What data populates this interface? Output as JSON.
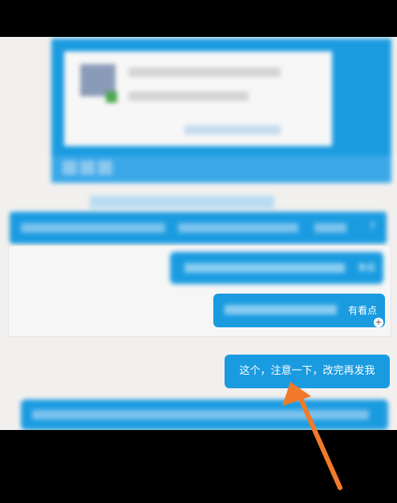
{
  "conversation": {
    "reply_message": "这个，注意一下，改完再发我",
    "partial_label": "有看点",
    "mini_label": "来自",
    "counter": "7"
  },
  "icons": {
    "add": "plus-icon",
    "annotation": "orange-arrow"
  },
  "colors": {
    "bubble_blue": "#1a9be0",
    "chat_background": "#f2f0ee",
    "arrow_orange": "#f07a2a"
  }
}
